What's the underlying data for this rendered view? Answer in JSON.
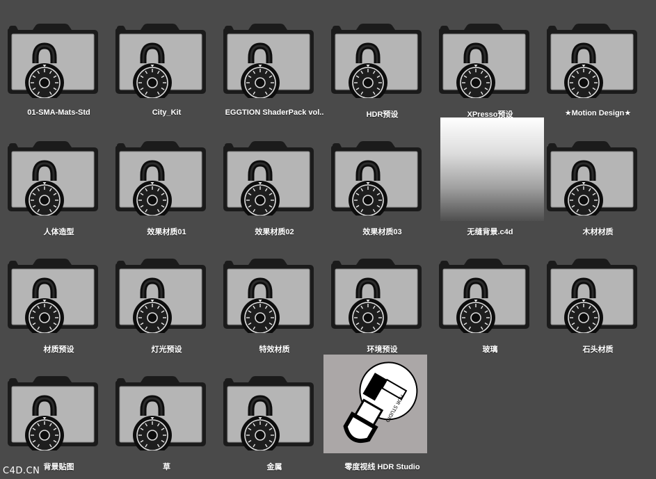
{
  "items": [
    {
      "label": "01-SMA-Mats-Std",
      "type": "locked-folder"
    },
    {
      "label": "City_Kit",
      "type": "locked-folder"
    },
    {
      "label": "EGGTION ShaderPack vol..",
      "type": "locked-folder"
    },
    {
      "label": "HDR预设",
      "type": "locked-folder"
    },
    {
      "label": "XPresso预设",
      "type": "locked-folder"
    },
    {
      "label": "★Motion Design★",
      "type": "locked-folder"
    },
    {
      "label": "人体造型",
      "type": "locked-folder"
    },
    {
      "label": "效果材质01",
      "type": "locked-folder"
    },
    {
      "label": "效果材质02",
      "type": "locked-folder"
    },
    {
      "label": "效果材质03",
      "type": "locked-folder"
    },
    {
      "label": "无缝背景.c4d",
      "type": "gradient-thumbnail"
    },
    {
      "label": "木材材质",
      "type": "locked-folder"
    },
    {
      "label": "材质预设",
      "type": "locked-folder"
    },
    {
      "label": "灯光预设",
      "type": "locked-folder"
    },
    {
      "label": "特效材质",
      "type": "locked-folder"
    },
    {
      "label": "环境预设",
      "type": "locked-folder"
    },
    {
      "label": "玻璃",
      "type": "locked-folder"
    },
    {
      "label": "石头材质",
      "type": "locked-folder"
    },
    {
      "label": "背景贴图",
      "type": "locked-folder"
    },
    {
      "label": "草",
      "type": "locked-folder"
    },
    {
      "label": "金属",
      "type": "locked-folder"
    },
    {
      "label": "零度视线 HDR Studio",
      "type": "hdr-app-icon"
    }
  ],
  "icons": {
    "locked-folder": "folder-lock-icon",
    "gradient-thumbnail": "gradient-file-thumbnail",
    "hdr-app-icon": "hdr-studio-app-icon"
  },
  "colors": {
    "background": "#4a4a4a",
    "folder_body": "#b3b3b3",
    "folder_outline": "#111111",
    "label_text": "#ffffff"
  },
  "watermark": "C4D.CN"
}
